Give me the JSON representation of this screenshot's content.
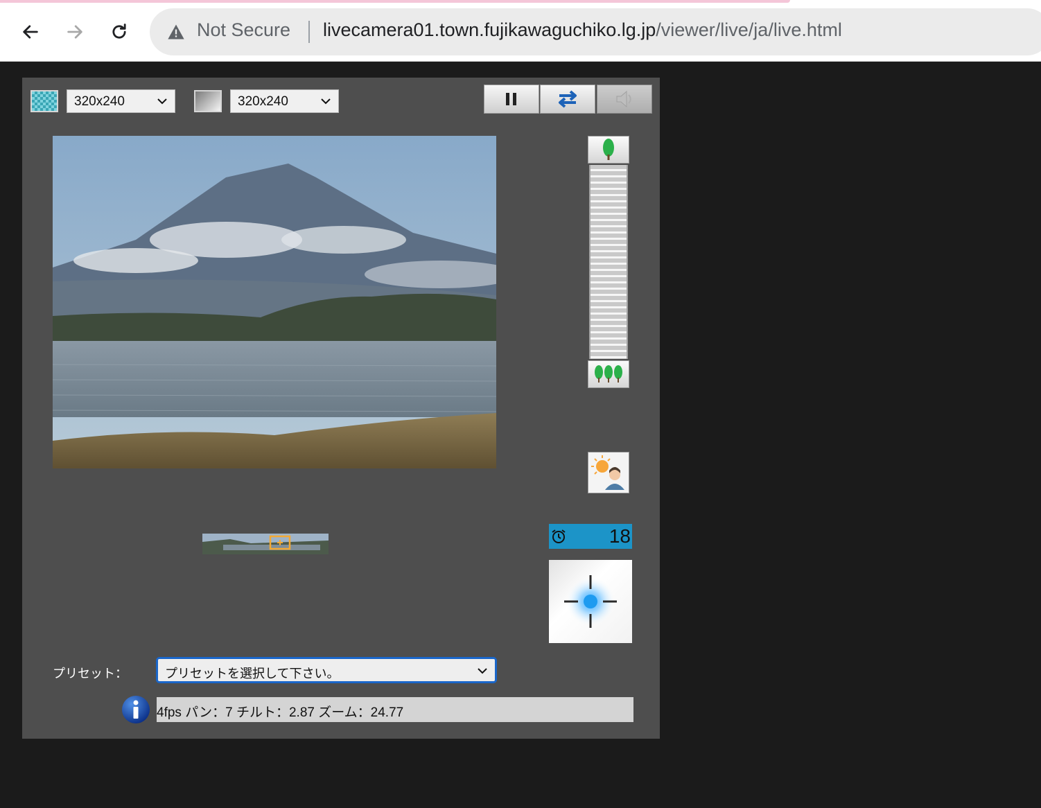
{
  "browser": {
    "back_icon": "arrow-left-icon",
    "forward_icon": "arrow-right-icon",
    "reload_icon": "reload-icon",
    "security_label": "Not Secure",
    "url_host": "livecamera01.town.fujikawaguchiko.lg.jp",
    "url_path": "/viewer/live/ja/live.html"
  },
  "viewer": {
    "image_quality_icon": "checker-pattern-icon",
    "resolution_select_1": "320x240",
    "image_capture_icon": "gradient-square-icon",
    "resolution_select_2": "320x240",
    "controls": [
      "pause-icon",
      "swap-arrows-icon",
      "speaker-icon"
    ],
    "zoom_in_icon": "single-tree-icon",
    "zoom_out_icon": "three-trees-icon",
    "backlight_icon": "sun-person-icon",
    "timer_icon": "alarm-clock-icon",
    "timer_value": "18",
    "aim_icon": "crosshair-icon",
    "preset_label": "プリセット：",
    "preset_select": "プリセットを選択して下さい。",
    "info_icon": "info-icon",
    "status_text": "4fps パン：7 チルト：2.87 ズーム：24.77",
    "colors": {
      "panel": "#4e4e4e",
      "timer_bg": "#1c94c8",
      "preset_focus": "#1a66c9"
    }
  }
}
